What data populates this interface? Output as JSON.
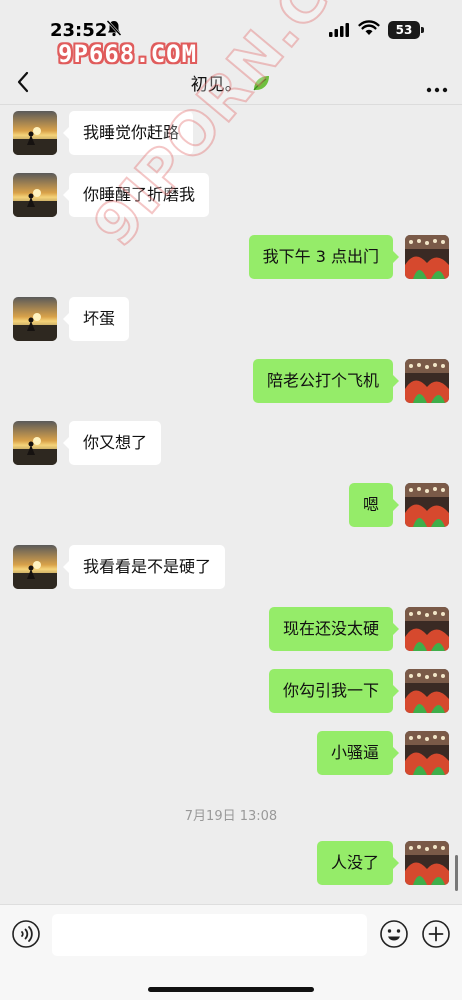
{
  "status_bar": {
    "time": "23:52",
    "battery": "53",
    "watermark": "9P668.COM"
  },
  "header": {
    "title": "初见。",
    "back_icon": "chevron-left-icon",
    "more_icon": "more-dots-icon",
    "leaf_icon": "leaf-emoji"
  },
  "watermark_diag": "9IPORN.COM",
  "messages": [
    {
      "side": "left",
      "text": "我睡觉你赶路"
    },
    {
      "side": "left",
      "text": "你睡醒了折磨我"
    },
    {
      "side": "right",
      "text": "我下午 3 点出门"
    },
    {
      "side": "left",
      "text": "坏蛋"
    },
    {
      "side": "right",
      "text": "陪老公打个飞机"
    },
    {
      "side": "left",
      "text": "你又想了"
    },
    {
      "side": "right",
      "text": "嗯"
    },
    {
      "side": "left",
      "text": "我看看是不是硬了"
    },
    {
      "side": "right",
      "text": "现在还没太硬"
    },
    {
      "side": "right",
      "text": "你勾引我一下"
    },
    {
      "side": "right",
      "text": "小骚逼"
    },
    {
      "side": "right",
      "text": "人没了"
    }
  ],
  "timestamp": "7月19日 13:08",
  "input_bar": {
    "placeholder": "",
    "voice_icon": "voice-icon",
    "emoji_icon": "emoji-icon",
    "plus_icon": "plus-icon"
  }
}
